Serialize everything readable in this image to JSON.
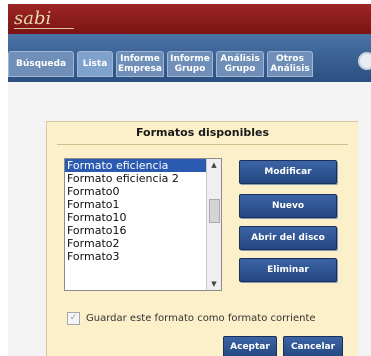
{
  "app": {
    "logo": "sabi"
  },
  "tabs": [
    {
      "line1": "Búsqueda",
      "line2": ""
    },
    {
      "line1": "Lista",
      "line2": ""
    },
    {
      "line1": "Informe",
      "line2": "Empresa"
    },
    {
      "line1": "Informe",
      "line2": "Grupo"
    },
    {
      "line1": "Análisis",
      "line2": "Grupo"
    },
    {
      "line1": "Otros",
      "line2": "Análisis"
    }
  ],
  "panel": {
    "title": "Formatos disponibles",
    "list_items": [
      "Formato eficiencia",
      "Formato eficiencia 2",
      "Formato0",
      "Formato1",
      "Formato10",
      "Formato16",
      "Formato2",
      "Formato3"
    ],
    "selected_index": 0,
    "buttons": {
      "modify": "Modificar",
      "new": "Nuevo",
      "open_disk": "Abrir del disco",
      "delete": "Eliminar"
    },
    "checkbox_label": "Guardar este formato como formato corriente",
    "checkbox_checked": true,
    "accept": "Aceptar",
    "cancel": "Cancelar"
  },
  "colors": {
    "topbar": "#8a1c1c",
    "navbar": "#3a6396",
    "panel_bg": "#fbf0c9",
    "button": "#2f5694",
    "selection": "#2a5bb0"
  }
}
